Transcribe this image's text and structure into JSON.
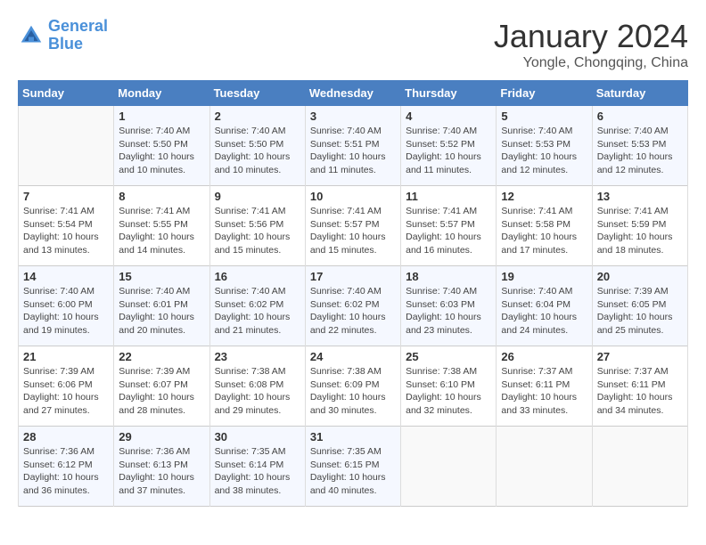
{
  "header": {
    "logo_line1": "General",
    "logo_line2": "Blue",
    "month_title": "January 2024",
    "location": "Yongle, Chongqing, China"
  },
  "days_of_week": [
    "Sunday",
    "Monday",
    "Tuesday",
    "Wednesday",
    "Thursday",
    "Friday",
    "Saturday"
  ],
  "weeks": [
    [
      {
        "day": "",
        "info": ""
      },
      {
        "day": "1",
        "info": "Sunrise: 7:40 AM\nSunset: 5:50 PM\nDaylight: 10 hours\nand 10 minutes."
      },
      {
        "day": "2",
        "info": "Sunrise: 7:40 AM\nSunset: 5:50 PM\nDaylight: 10 hours\nand 10 minutes."
      },
      {
        "day": "3",
        "info": "Sunrise: 7:40 AM\nSunset: 5:51 PM\nDaylight: 10 hours\nand 11 minutes."
      },
      {
        "day": "4",
        "info": "Sunrise: 7:40 AM\nSunset: 5:52 PM\nDaylight: 10 hours\nand 11 minutes."
      },
      {
        "day": "5",
        "info": "Sunrise: 7:40 AM\nSunset: 5:53 PM\nDaylight: 10 hours\nand 12 minutes."
      },
      {
        "day": "6",
        "info": "Sunrise: 7:40 AM\nSunset: 5:53 PM\nDaylight: 10 hours\nand 12 minutes."
      }
    ],
    [
      {
        "day": "7",
        "info": "Sunrise: 7:41 AM\nSunset: 5:54 PM\nDaylight: 10 hours\nand 13 minutes."
      },
      {
        "day": "8",
        "info": "Sunrise: 7:41 AM\nSunset: 5:55 PM\nDaylight: 10 hours\nand 14 minutes."
      },
      {
        "day": "9",
        "info": "Sunrise: 7:41 AM\nSunset: 5:56 PM\nDaylight: 10 hours\nand 15 minutes."
      },
      {
        "day": "10",
        "info": "Sunrise: 7:41 AM\nSunset: 5:57 PM\nDaylight: 10 hours\nand 15 minutes."
      },
      {
        "day": "11",
        "info": "Sunrise: 7:41 AM\nSunset: 5:57 PM\nDaylight: 10 hours\nand 16 minutes."
      },
      {
        "day": "12",
        "info": "Sunrise: 7:41 AM\nSunset: 5:58 PM\nDaylight: 10 hours\nand 17 minutes."
      },
      {
        "day": "13",
        "info": "Sunrise: 7:41 AM\nSunset: 5:59 PM\nDaylight: 10 hours\nand 18 minutes."
      }
    ],
    [
      {
        "day": "14",
        "info": "Sunrise: 7:40 AM\nSunset: 6:00 PM\nDaylight: 10 hours\nand 19 minutes."
      },
      {
        "day": "15",
        "info": "Sunrise: 7:40 AM\nSunset: 6:01 PM\nDaylight: 10 hours\nand 20 minutes."
      },
      {
        "day": "16",
        "info": "Sunrise: 7:40 AM\nSunset: 6:02 PM\nDaylight: 10 hours\nand 21 minutes."
      },
      {
        "day": "17",
        "info": "Sunrise: 7:40 AM\nSunset: 6:02 PM\nDaylight: 10 hours\nand 22 minutes."
      },
      {
        "day": "18",
        "info": "Sunrise: 7:40 AM\nSunset: 6:03 PM\nDaylight: 10 hours\nand 23 minutes."
      },
      {
        "day": "19",
        "info": "Sunrise: 7:40 AM\nSunset: 6:04 PM\nDaylight: 10 hours\nand 24 minutes."
      },
      {
        "day": "20",
        "info": "Sunrise: 7:39 AM\nSunset: 6:05 PM\nDaylight: 10 hours\nand 25 minutes."
      }
    ],
    [
      {
        "day": "21",
        "info": "Sunrise: 7:39 AM\nSunset: 6:06 PM\nDaylight: 10 hours\nand 27 minutes."
      },
      {
        "day": "22",
        "info": "Sunrise: 7:39 AM\nSunset: 6:07 PM\nDaylight: 10 hours\nand 28 minutes."
      },
      {
        "day": "23",
        "info": "Sunrise: 7:38 AM\nSunset: 6:08 PM\nDaylight: 10 hours\nand 29 minutes."
      },
      {
        "day": "24",
        "info": "Sunrise: 7:38 AM\nSunset: 6:09 PM\nDaylight: 10 hours\nand 30 minutes."
      },
      {
        "day": "25",
        "info": "Sunrise: 7:38 AM\nSunset: 6:10 PM\nDaylight: 10 hours\nand 32 minutes."
      },
      {
        "day": "26",
        "info": "Sunrise: 7:37 AM\nSunset: 6:11 PM\nDaylight: 10 hours\nand 33 minutes."
      },
      {
        "day": "27",
        "info": "Sunrise: 7:37 AM\nSunset: 6:11 PM\nDaylight: 10 hours\nand 34 minutes."
      }
    ],
    [
      {
        "day": "28",
        "info": "Sunrise: 7:36 AM\nSunset: 6:12 PM\nDaylight: 10 hours\nand 36 minutes."
      },
      {
        "day": "29",
        "info": "Sunrise: 7:36 AM\nSunset: 6:13 PM\nDaylight: 10 hours\nand 37 minutes."
      },
      {
        "day": "30",
        "info": "Sunrise: 7:35 AM\nSunset: 6:14 PM\nDaylight: 10 hours\nand 38 minutes."
      },
      {
        "day": "31",
        "info": "Sunrise: 7:35 AM\nSunset: 6:15 PM\nDaylight: 10 hours\nand 40 minutes."
      },
      {
        "day": "",
        "info": ""
      },
      {
        "day": "",
        "info": ""
      },
      {
        "day": "",
        "info": ""
      }
    ]
  ]
}
